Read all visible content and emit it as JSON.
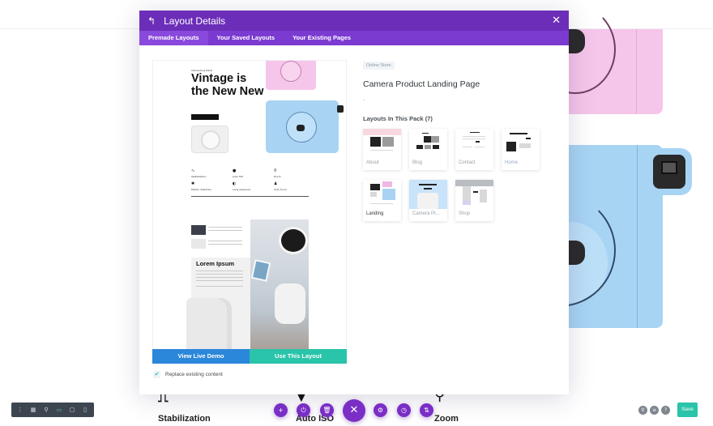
{
  "modal": {
    "title": "Layout Details",
    "back_icon": "back-arrow-icon",
    "close_icon": "close-icon",
    "tabs": [
      {
        "label": "Premade Layouts",
        "active": true
      },
      {
        "label": "Your Saved Layouts",
        "active": false
      },
      {
        "label": "Your Existing Pages",
        "active": false
      }
    ],
    "preview": {
      "eyebrow": "Introducing DSLR",
      "hero_heading": "Vintage is the New New",
      "features": [
        "Stabilization",
        "Auto ISO",
        "Zoom",
        "Motion detection",
        "Long exposure",
        "Auto focus"
      ],
      "section_heading": "Lorem Ipsum",
      "view_demo_label": "View Live Demo",
      "use_layout_label": "Use This Layout"
    },
    "replace_existing": {
      "label": "Replace existing content",
      "checked": true
    },
    "details": {
      "category_badge": "Online Store",
      "layout_name": "Camera Product Landing Page",
      "description": ".",
      "pack_heading": "Layouts In This Pack (7)",
      "pack_layouts": [
        {
          "label": "About",
          "active": false
        },
        {
          "label": "Blog",
          "active": false
        },
        {
          "label": "Contact",
          "active": false
        },
        {
          "label": "Home",
          "active": false
        },
        {
          "label": "Landing",
          "active": true
        },
        {
          "label": "Camera Pr...",
          "active": false
        },
        {
          "label": "Shop",
          "active": false
        }
      ]
    }
  },
  "background": {
    "feature_labels": [
      "Stabilization",
      "Auto ISO",
      "Zoom"
    ]
  },
  "left_toolbar": {
    "icons": [
      "more-options-icon",
      "wireframe-icon",
      "zoom-icon",
      "desktop-view-icon",
      "tablet-view-icon",
      "phone-view-icon"
    ]
  },
  "action_bar": {
    "icons": [
      "add-icon",
      "power-icon",
      "trash-icon",
      "close-icon",
      "settings-icon",
      "history-icon",
      "sort-icon"
    ]
  },
  "right_controls": {
    "icons": [
      "search-icon",
      "layers-icon",
      "help-icon"
    ],
    "save_label": "Save"
  },
  "colors": {
    "header_purple": "#6c2eb9",
    "tab_purple": "#7b3bd1",
    "demo_blue": "#2b87da",
    "use_green": "#29c4a9",
    "fab_purple": "#7a2ec6"
  }
}
